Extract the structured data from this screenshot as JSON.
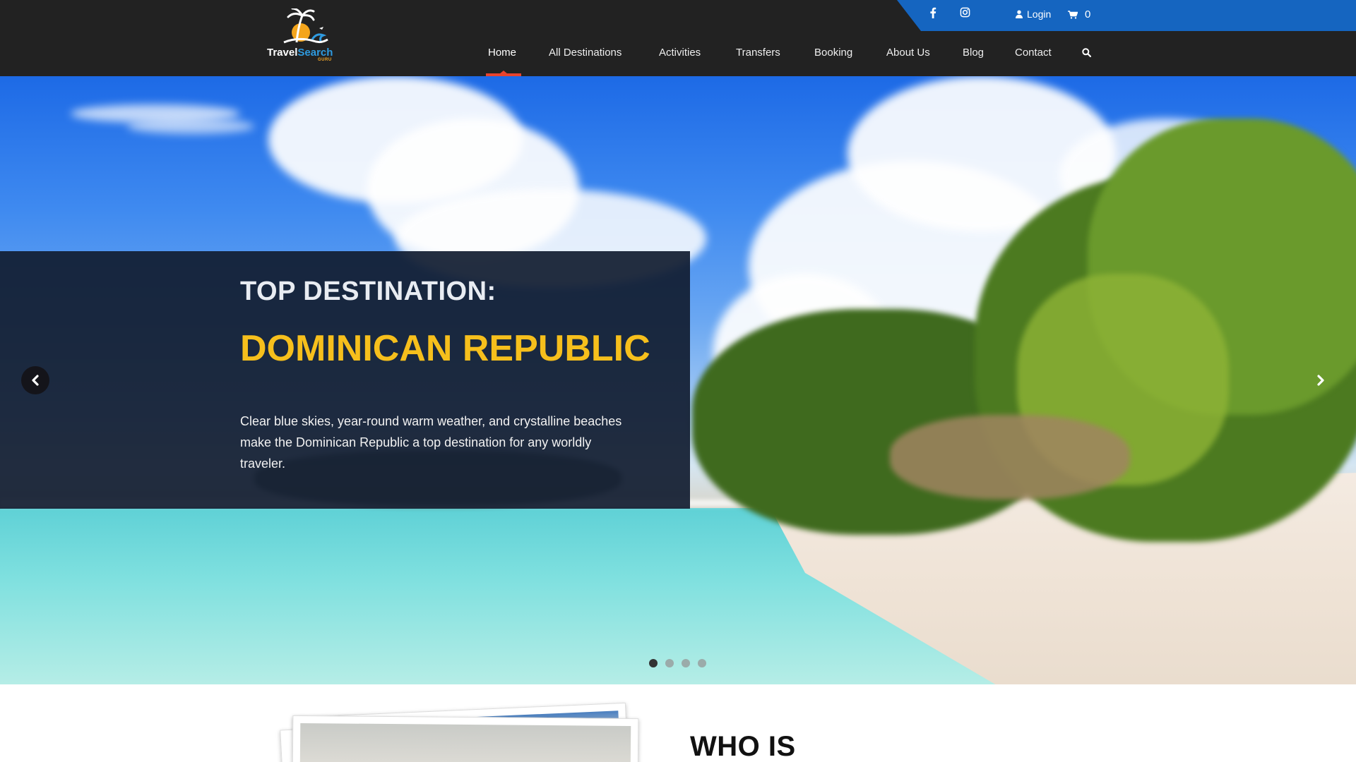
{
  "brand": {
    "name_part1": "Travel",
    "name_part2": "Search",
    "tagline": "GURU"
  },
  "topbar": {
    "social": [
      "facebook-icon",
      "instagram-icon"
    ],
    "login_label": "Login",
    "cart_count": "0"
  },
  "nav": {
    "items": [
      "Home",
      "All Destinations",
      "Activities",
      "Transfers",
      "Booking",
      "About Us",
      "Blog",
      "Contact"
    ],
    "active": "Home",
    "search_icon": "search-icon"
  },
  "hero": {
    "kicker": "TOP DESTINATION:",
    "title": "DOMINICAN REPUBLIC",
    "text": "Clear blue skies, year-round warm weather, and crystalline beaches make the Dominican Republic a top destination for any worldly traveler.",
    "slides_total": 4,
    "active_slide": 1
  },
  "section": {
    "heading": "WHO IS"
  },
  "colors": {
    "header_bg": "#222222",
    "topbar_bg": "#1565c0",
    "accent": "#e8432e",
    "title_yellow": "#f6bf1c",
    "caption_bg": "#111c30"
  }
}
